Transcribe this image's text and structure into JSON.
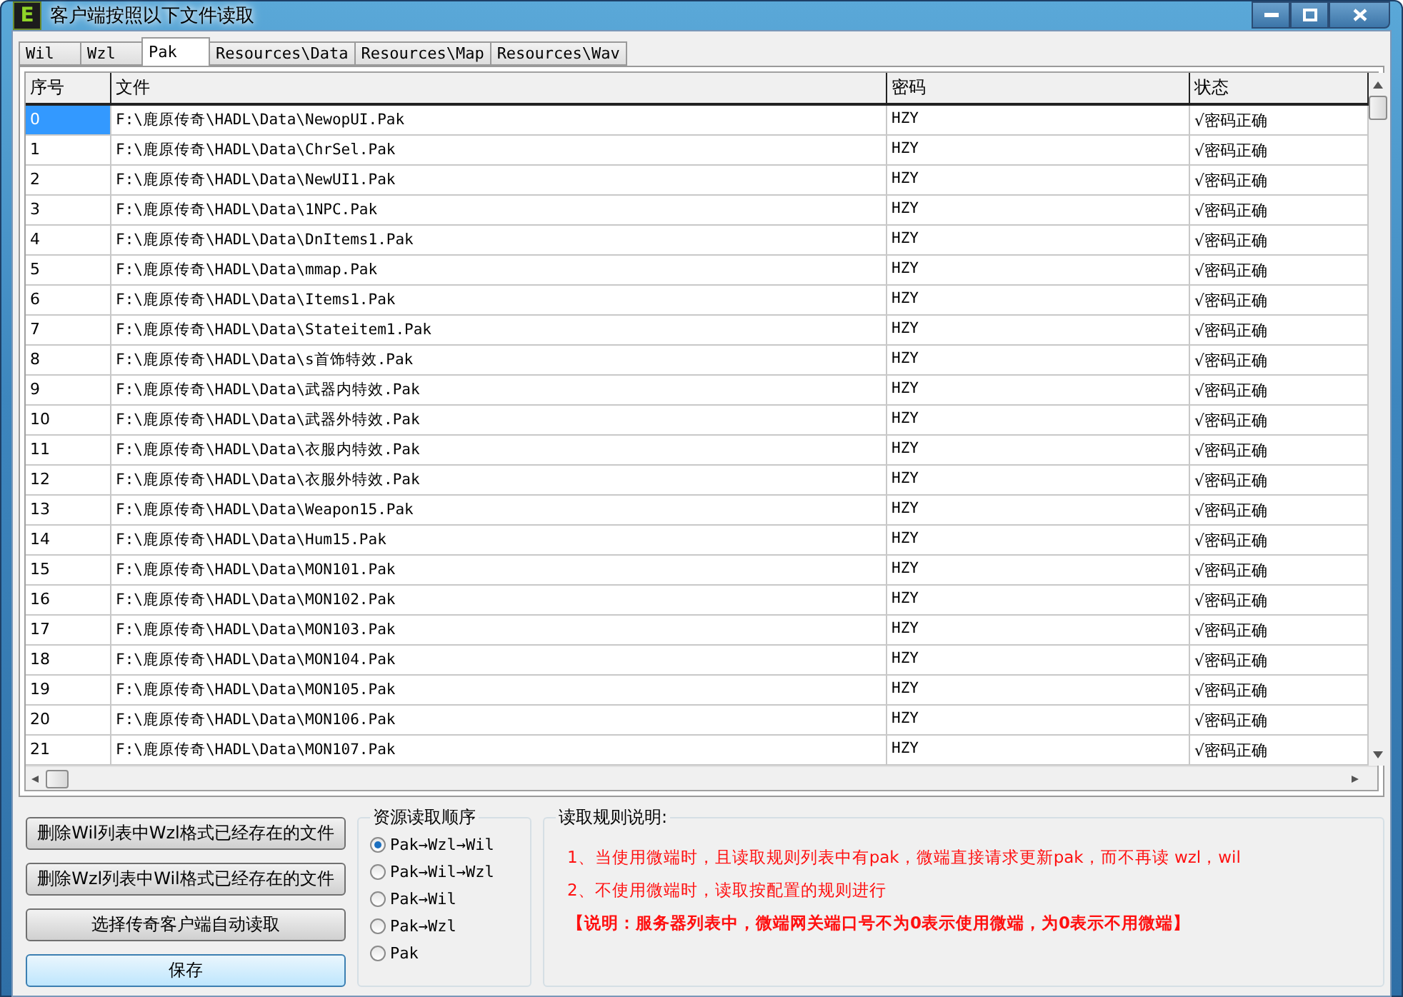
{
  "window": {
    "icon_letter": "E",
    "title": "客户端按照以下文件读取"
  },
  "tabs": [
    {
      "label": "Wil",
      "selected": false
    },
    {
      "label": "Wzl",
      "selected": false
    },
    {
      "label": "Pak",
      "selected": true
    },
    {
      "label": "Resources\\Data",
      "selected": false
    },
    {
      "label": "Resources\\Map",
      "selected": false
    },
    {
      "label": "Resources\\Wav",
      "selected": false
    }
  ],
  "table": {
    "columns": [
      "序号",
      "文件",
      "密码",
      "状态"
    ],
    "rows": [
      {
        "no": "0",
        "file": "F:\\鹿原传奇\\HADL\\Data\\NewopUI.Pak",
        "password": "HZY",
        "status": "√密码正确",
        "selected": true
      },
      {
        "no": "1",
        "file": "F:\\鹿原传奇\\HADL\\Data\\ChrSel.Pak",
        "password": "HZY",
        "status": "√密码正确",
        "selected": false
      },
      {
        "no": "2",
        "file": "F:\\鹿原传奇\\HADL\\Data\\NewUI1.Pak",
        "password": "HZY",
        "status": "√密码正确",
        "selected": false
      },
      {
        "no": "3",
        "file": "F:\\鹿原传奇\\HADL\\Data\\1NPC.Pak",
        "password": "HZY",
        "status": "√密码正确",
        "selected": false
      },
      {
        "no": "4",
        "file": "F:\\鹿原传奇\\HADL\\Data\\DnItems1.Pak",
        "password": "HZY",
        "status": "√密码正确",
        "selected": false
      },
      {
        "no": "5",
        "file": "F:\\鹿原传奇\\HADL\\Data\\mmap.Pak",
        "password": "HZY",
        "status": "√密码正确",
        "selected": false
      },
      {
        "no": "6",
        "file": "F:\\鹿原传奇\\HADL\\Data\\Items1.Pak",
        "password": "HZY",
        "status": "√密码正确",
        "selected": false
      },
      {
        "no": "7",
        "file": "F:\\鹿原传奇\\HADL\\Data\\Stateitem1.Pak",
        "password": "HZY",
        "status": "√密码正确",
        "selected": false
      },
      {
        "no": "8",
        "file": "F:\\鹿原传奇\\HADL\\Data\\s首饰特效.Pak",
        "password": "HZY",
        "status": "√密码正确",
        "selected": false
      },
      {
        "no": "9",
        "file": "F:\\鹿原传奇\\HADL\\Data\\武器内特效.Pak",
        "password": "HZY",
        "status": "√密码正确",
        "selected": false
      },
      {
        "no": "10",
        "file": "F:\\鹿原传奇\\HADL\\Data\\武器外特效.Pak",
        "password": "HZY",
        "status": "√密码正确",
        "selected": false
      },
      {
        "no": "11",
        "file": "F:\\鹿原传奇\\HADL\\Data\\衣服内特效.Pak",
        "password": "HZY",
        "status": "√密码正确",
        "selected": false
      },
      {
        "no": "12",
        "file": "F:\\鹿原传奇\\HADL\\Data\\衣服外特效.Pak",
        "password": "HZY",
        "status": "√密码正确",
        "selected": false
      },
      {
        "no": "13",
        "file": "F:\\鹿原传奇\\HADL\\Data\\Weapon15.Pak",
        "password": "HZY",
        "status": "√密码正确",
        "selected": false
      },
      {
        "no": "14",
        "file": "F:\\鹿原传奇\\HADL\\Data\\Hum15.Pak",
        "password": "HZY",
        "status": "√密码正确",
        "selected": false
      },
      {
        "no": "15",
        "file": "F:\\鹿原传奇\\HADL\\Data\\MON101.Pak",
        "password": "HZY",
        "status": "√密码正确",
        "selected": false
      },
      {
        "no": "16",
        "file": "F:\\鹿原传奇\\HADL\\Data\\MON102.Pak",
        "password": "HZY",
        "status": "√密码正确",
        "selected": false
      },
      {
        "no": "17",
        "file": "F:\\鹿原传奇\\HADL\\Data\\MON103.Pak",
        "password": "HZY",
        "status": "√密码正确",
        "selected": false
      },
      {
        "no": "18",
        "file": "F:\\鹿原传奇\\HADL\\Data\\MON104.Pak",
        "password": "HZY",
        "status": "√密码正确",
        "selected": false
      },
      {
        "no": "19",
        "file": "F:\\鹿原传奇\\HADL\\Data\\MON105.Pak",
        "password": "HZY",
        "status": "√密码正确",
        "selected": false
      },
      {
        "no": "20",
        "file": "F:\\鹿原传奇\\HADL\\Data\\MON106.Pak",
        "password": "HZY",
        "status": "√密码正确",
        "selected": false
      },
      {
        "no": "21",
        "file": "F:\\鹿原传奇\\HADL\\Data\\MON107.Pak",
        "password": "HZY",
        "status": "√密码正确",
        "selected": false
      }
    ]
  },
  "buttons": [
    {
      "label": "删除Wil列表中Wzl格式已经存在的文件",
      "kind": "normal"
    },
    {
      "label": "删除Wzl列表中Wil格式已经存在的文件",
      "kind": "normal"
    },
    {
      "label": "选择传奇客户端自动读取",
      "kind": "normal"
    },
    {
      "label": "保存",
      "kind": "default"
    }
  ],
  "read_order": {
    "title": "资源读取顺序",
    "options": [
      {
        "label": "Pak→Wzl→Wil",
        "selected": true
      },
      {
        "label": "Pak→Wil→Wzl",
        "selected": false
      },
      {
        "label": "Pak→Wil",
        "selected": false
      },
      {
        "label": "Pak→Wzl",
        "selected": false
      },
      {
        "label": "Pak",
        "selected": false
      }
    ]
  },
  "rules": {
    "title": "读取规则说明:",
    "lines": [
      "1、当使用微端时，且读取规则列表中有pak，微端直接请求更新pak，而不再读 wzl，wil",
      "2、不使用微端时，读取按配置的规则进行",
      "【说明：服务器列表中，微端网关端口号不为0表示使用微端，为0表示不用微端】"
    ]
  }
}
